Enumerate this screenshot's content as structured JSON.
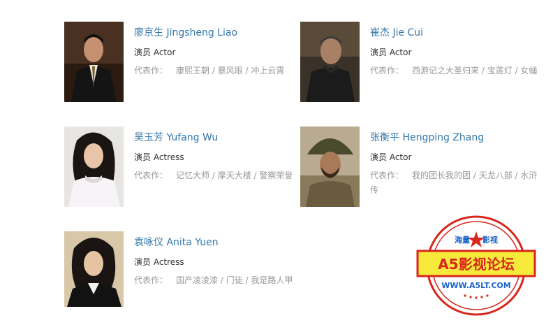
{
  "celebrities": [
    {
      "name": "廖京生 Jingsheng Liao",
      "role": "演员 Actor",
      "works_label": "代表作：",
      "works": [
        "康熙王朝",
        "暴风眼",
        "冲上云霄"
      ]
    },
    {
      "name": "崔杰 Jie Cui",
      "role": "演员 Actor",
      "works_label": "代表作：",
      "works": [
        "西游记之大圣归来",
        "宝莲灯",
        "女蛹"
      ]
    },
    {
      "name": "吴玉芳 Yufang Wu",
      "role": "演员 Actress",
      "works_label": "代表作：",
      "works": [
        "记忆大师",
        "摩天大楼",
        "警察荣誉"
      ]
    },
    {
      "name": "张衡平 Hengping Zhang",
      "role": "演员 Actor",
      "works_label": "代表作：",
      "works": [
        "我的团长我的团",
        "天龙八部",
        "水浒传"
      ]
    },
    {
      "name": "袁咏仪 Anita Yuen",
      "role": "演员 Actress",
      "works_label": "代表作：",
      "works": [
        "国产凌凌漆",
        "门徒",
        "我是路人甲"
      ]
    }
  ],
  "watermark": {
    "top_left": "海量",
    "top_right": "影视",
    "title": "A5影视论坛",
    "url": "WWW.A5LT.COM",
    "colors": {
      "red": "#d8261c",
      "blue": "#1a62c8",
      "yellow": "#f7ea3a"
    }
  }
}
